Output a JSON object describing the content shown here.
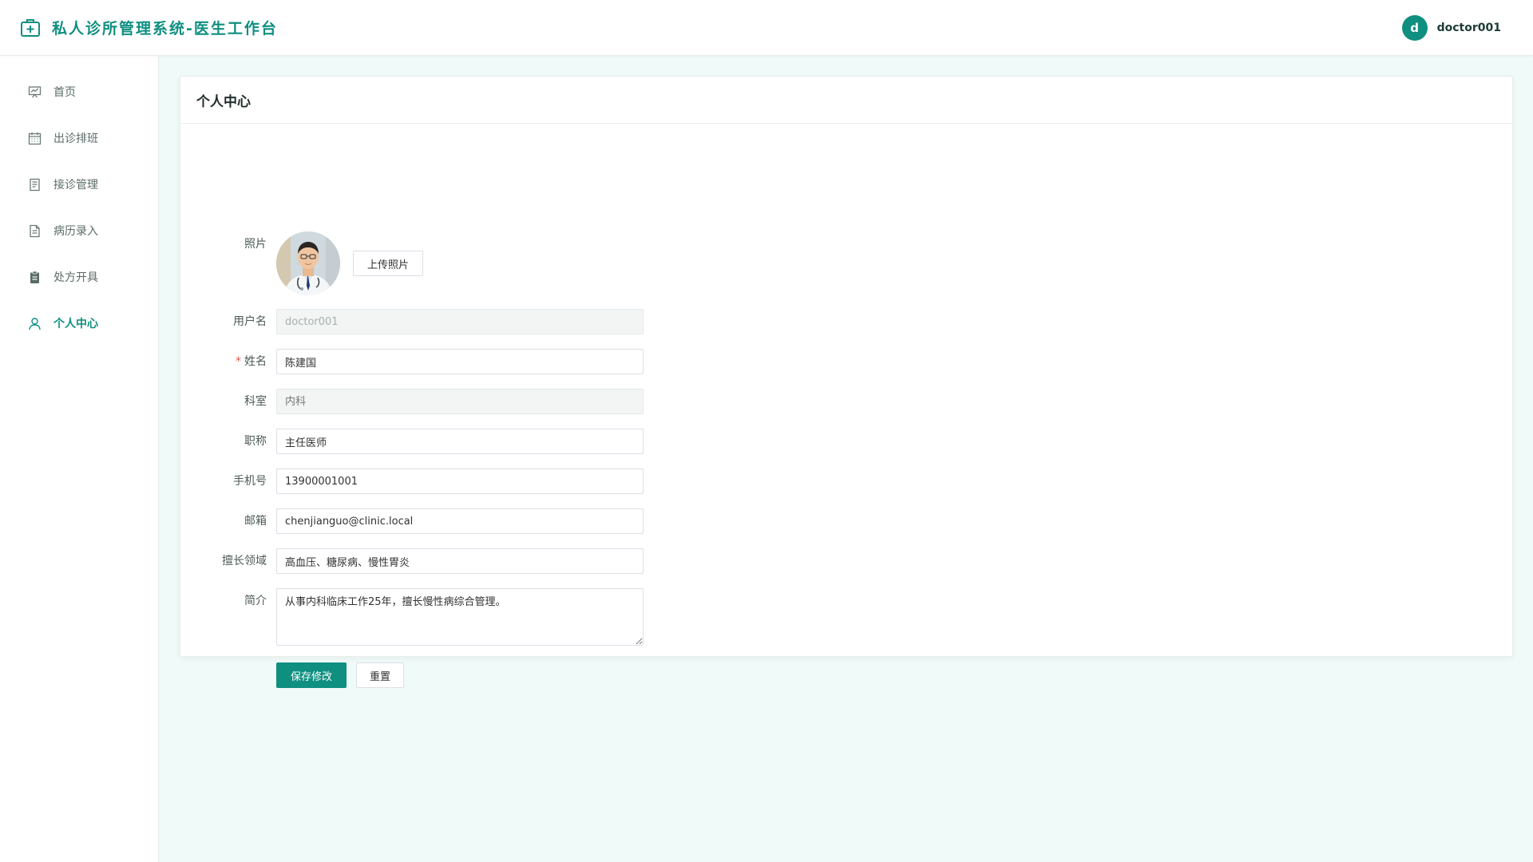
{
  "header": {
    "title": "私人诊所管理系统-医生工作台",
    "user_initial": "d",
    "user_name": "doctor001"
  },
  "sidebar": {
    "items": [
      {
        "label": "首页",
        "icon": "chart-board-icon",
        "active": false
      },
      {
        "label": "出诊排班",
        "icon": "calendar-icon",
        "active": false
      },
      {
        "label": "接诊管理",
        "icon": "document-list-icon",
        "active": false
      },
      {
        "label": "病历录入",
        "icon": "file-text-icon",
        "active": false
      },
      {
        "label": "处方开具",
        "icon": "clipboard-icon",
        "active": false
      },
      {
        "label": "个人中心",
        "icon": "user-icon",
        "active": true
      }
    ]
  },
  "card": {
    "title": "个人中心"
  },
  "form": {
    "photo_label": "照片",
    "upload_label": "上传照片",
    "username_label": "用户名",
    "username_value": "doctor001",
    "name_required_mark": "*",
    "name_label": "姓名",
    "name_value": "陈建国",
    "department_label": "科室",
    "department_placeholder": "内科",
    "title_label": "职称",
    "title_value": "主任医师",
    "phone_label": "手机号",
    "phone_value": "13900001001",
    "email_label": "邮箱",
    "email_value": "chenjianguo@clinic.local",
    "specialty_label": "擅长领域",
    "specialty_value": "高血压、糖尿病、慢性胃炎",
    "intro_label": "简介",
    "intro_value": "从事内科临床工作25年，擅长慢性病综合管理。",
    "save_label": "保存修改",
    "reset_label": "重置"
  },
  "colors": {
    "accent": "#0f8f80",
    "background": "#f0faf8"
  }
}
